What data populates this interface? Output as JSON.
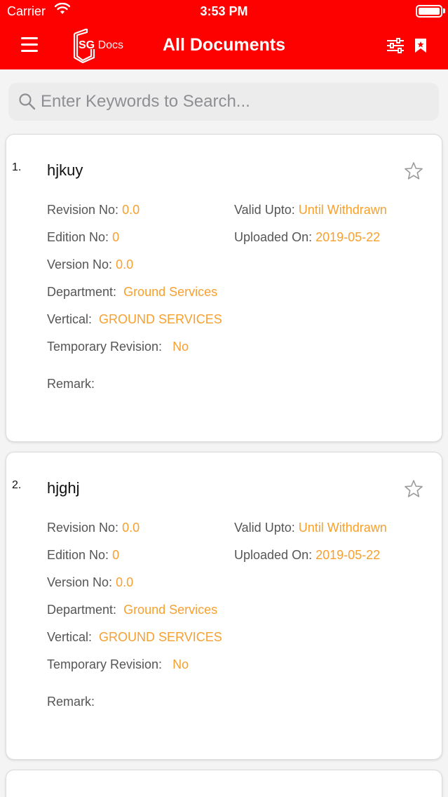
{
  "status_bar": {
    "carrier": "Carrier",
    "time": "3:53 PM"
  },
  "header": {
    "logo_sg": "SG",
    "logo_docs": "Docs",
    "title": "All Documents"
  },
  "search": {
    "placeholder": "Enter Keywords to Search..."
  },
  "colors": {
    "header_bg": "#fd0000",
    "value_accent": "#f7a030"
  },
  "documents": [
    {
      "index": "1.",
      "name": "hjkuy",
      "revision_label": "Revision No:",
      "revision": "0.0",
      "valid_label": "Valid Upto:",
      "valid": "Until Withdrawn",
      "edition_label": "Edition No:",
      "edition": "0",
      "uploaded_label": "Uploaded On:",
      "uploaded": "2019-05-22",
      "version_label": "Version No:",
      "version": "0.0",
      "department_label": "Department:",
      "department": "Ground Services",
      "vertical_label": "Vertical:",
      "vertical": "GROUND SERVICES",
      "temp_label": "Temporary Revision:",
      "temp": "No",
      "remark_label": "Remark:"
    },
    {
      "index": "2.",
      "name": "hjghj",
      "revision_label": "Revision No:",
      "revision": "0.0",
      "valid_label": "Valid Upto:",
      "valid": "Until Withdrawn",
      "edition_label": "Edition No:",
      "edition": "0",
      "uploaded_label": "Uploaded On:",
      "uploaded": "2019-05-22",
      "version_label": "Version No:",
      "version": "0.0",
      "department_label": "Department:",
      "department": "Ground Services",
      "vertical_label": "Vertical:",
      "vertical": "GROUND SERVICES",
      "temp_label": "Temporary Revision:",
      "temp": "No",
      "remark_label": "Remark:"
    }
  ]
}
